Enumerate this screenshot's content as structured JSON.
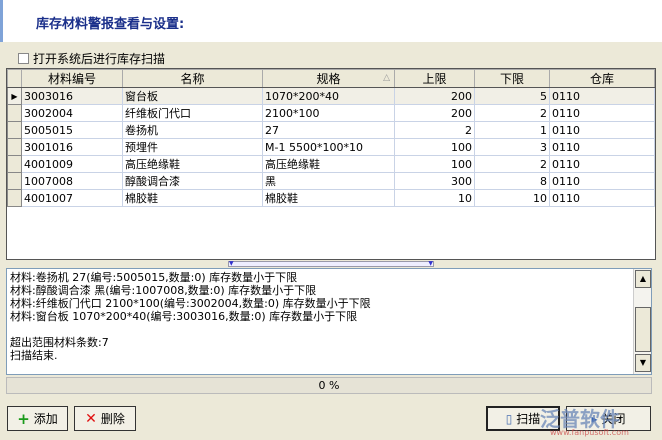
{
  "header": {
    "title": "库存材料警报查看与设置:"
  },
  "scan_on_start": {
    "label": "打开系统后进行库存扫描",
    "checked": false
  },
  "grid": {
    "columns": [
      "材料编号",
      "名称",
      "规格",
      "上限",
      "下限",
      "仓库"
    ],
    "sort_indicator": "△",
    "rows": [
      [
        "3003016",
        "窗台板",
        "1070*200*40",
        "200",
        "5",
        "0110"
      ],
      [
        "3002004",
        "纤维板门代口",
        "2100*100",
        "200",
        "2",
        "0110"
      ],
      [
        "5005015",
        "卷扬机",
        "27",
        "2",
        "1",
        "0110"
      ],
      [
        "3001016",
        "预埋件",
        "M-1 5500*100*10",
        "100",
        "3",
        "0110"
      ],
      [
        "4001009",
        "高压绝缘鞋",
        "高压绝缘鞋",
        "100",
        "2",
        "0110"
      ],
      [
        "1007008",
        "醇酸调合漆",
        "黑",
        "300",
        "8",
        "0110"
      ],
      [
        "4001007",
        "棉胶鞋",
        "棉胶鞋",
        "10",
        "10",
        "0110"
      ]
    ]
  },
  "log": {
    "lines": [
      "材料:卷扬机 27(编号:5005015,数量:0) 库存数量小于下限",
      "材料:醇酸调合漆 黑(编号:1007008,数量:0) 库存数量小于下限",
      "材料:纤维板门代口 2100*100(编号:3002004,数量:0) 库存数量小于下限",
      "材料:窗台板 1070*200*40(编号:3003016,数量:0) 库存数量小于下限",
      "",
      "超出范围材料条数:7",
      "扫描结束."
    ]
  },
  "progress": {
    "text": "0 %",
    "value": 0
  },
  "buttons": {
    "add": "添加",
    "delete": "删除",
    "scan": "扫描",
    "close": "关闭"
  },
  "watermark": {
    "brand": "泛普软件",
    "url": "www.fanpusoft.com"
  }
}
